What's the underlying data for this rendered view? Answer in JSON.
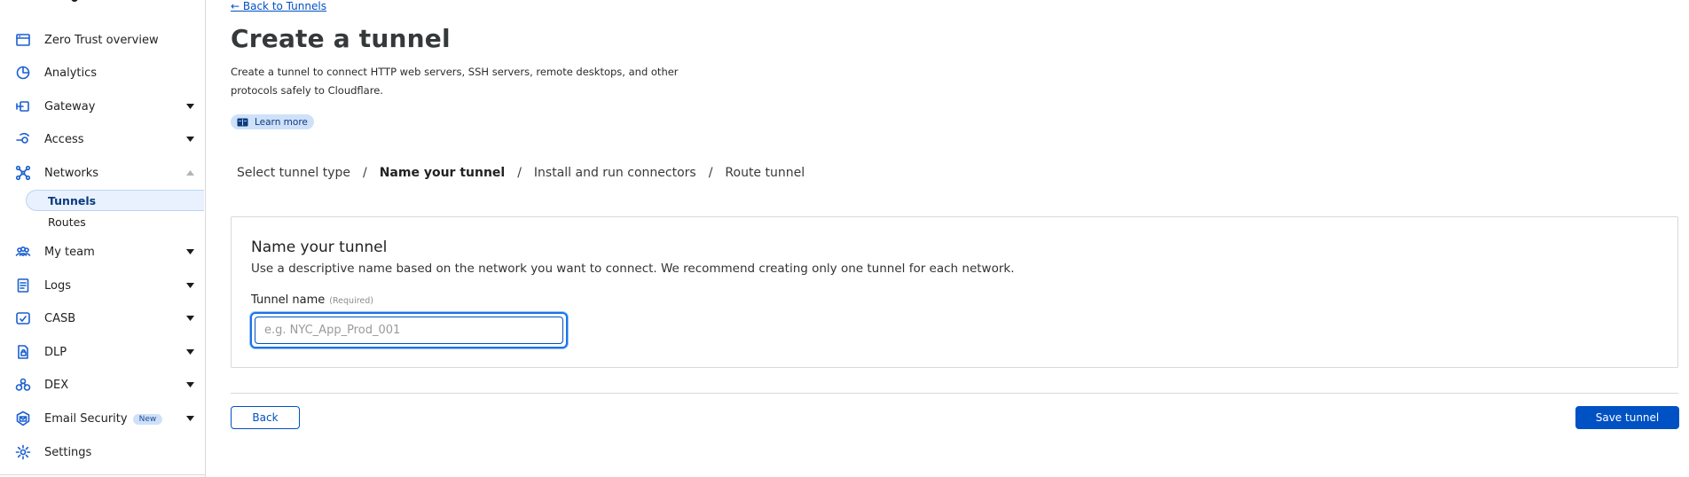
{
  "sidebar": {
    "items": [
      {
        "label": "Zero Trust overview",
        "icon": "browser-window-icon"
      },
      {
        "label": "Analytics",
        "icon": "pie-chart-icon"
      },
      {
        "label": "Gateway",
        "icon": "gateway-icon"
      },
      {
        "label": "Access",
        "icon": "access-icon"
      },
      {
        "label": "Networks",
        "icon": "network-icon"
      },
      {
        "label": "My team",
        "icon": "team-icon"
      },
      {
        "label": "Logs",
        "icon": "logs-icon"
      },
      {
        "label": "CASB",
        "icon": "casb-icon"
      },
      {
        "label": "DLP",
        "icon": "dlp-icon"
      },
      {
        "label": "DEX",
        "icon": "dex-icon"
      },
      {
        "label": "Email Security",
        "icon": "email-security-icon",
        "badge": "New"
      },
      {
        "label": "Settings",
        "icon": "gear-icon"
      }
    ],
    "networks_sub": [
      {
        "label": "Tunnels",
        "active": true
      },
      {
        "label": "Routes",
        "active": false
      }
    ]
  },
  "main": {
    "back_link": "← Back to Tunnels",
    "title": "Create a tunnel",
    "description": "Create a tunnel to connect HTTP web servers, SSH servers, remote desktops, and other protocols safely to Cloudflare.",
    "learn_more": "Learn more",
    "steps": [
      "Select tunnel type",
      "Name your tunnel",
      "Install and run connectors",
      "Route tunnel"
    ],
    "current_step": "Name your tunnel",
    "step_separator": "/",
    "card": {
      "title": "Name your tunnel",
      "description": "Use a descriptive name based on the network you want to connect. We recommend creating only one tunnel for each network.",
      "field_label": "Tunnel name",
      "field_required": "(Required)",
      "field_placeholder": "e.g. NYC_App_Prod_001",
      "field_value": ""
    },
    "back_button": "Back",
    "save_button": "Save tunnel"
  },
  "colors": {
    "accent": "#0051c3",
    "icon_blue": "#1a5fd0",
    "badge_bg": "#cfe1f9",
    "active_nav_bg": "#e8f1fd"
  }
}
